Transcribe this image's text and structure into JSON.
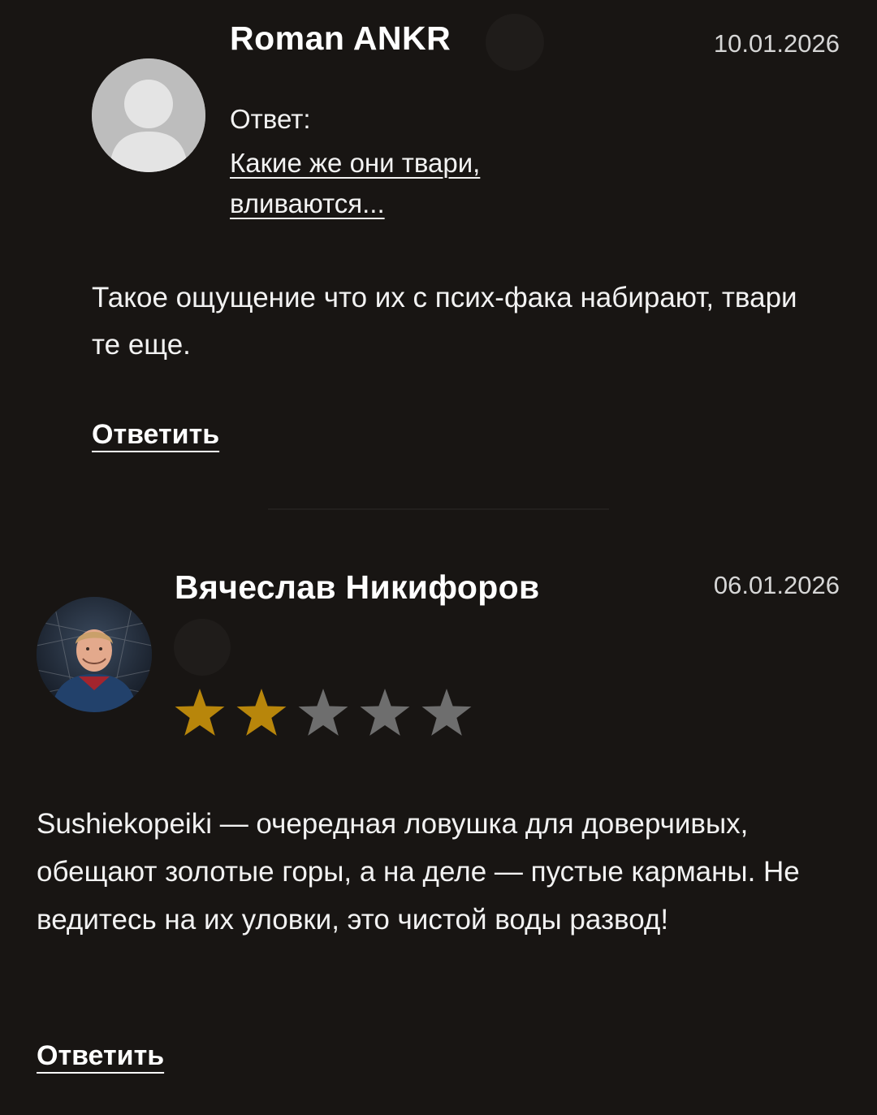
{
  "reviews": [
    {
      "author": "Roman ANKR",
      "date": "10.01.2026",
      "avatar_icon": "default-user-icon",
      "reply_label": "Ответ:",
      "reply_link": "Какие же они твари, вливаются...",
      "text": "Такое ощущение что их с псих-фака набирают, твари те еще.",
      "reply_button": "Ответить"
    },
    {
      "author": "Вячеслав Никифоров",
      "date": "06.01.2026",
      "avatar_icon": "user-photo",
      "rating": 2,
      "rating_max": 5,
      "text": "Sushiekopeiki — очередная ловушка для доверчивых, обещают золотые горы, а на деле — пустые карманы. Не ведитесь на их уловки, это чистой воды развод!",
      "reply_button": "Ответить"
    }
  ],
  "colors": {
    "background": "#181513",
    "text": "#ffffff",
    "star_filled": "#b8860b",
    "star_empty": "#6e6e6e",
    "avatar_placeholder": "#bdbdbd"
  }
}
